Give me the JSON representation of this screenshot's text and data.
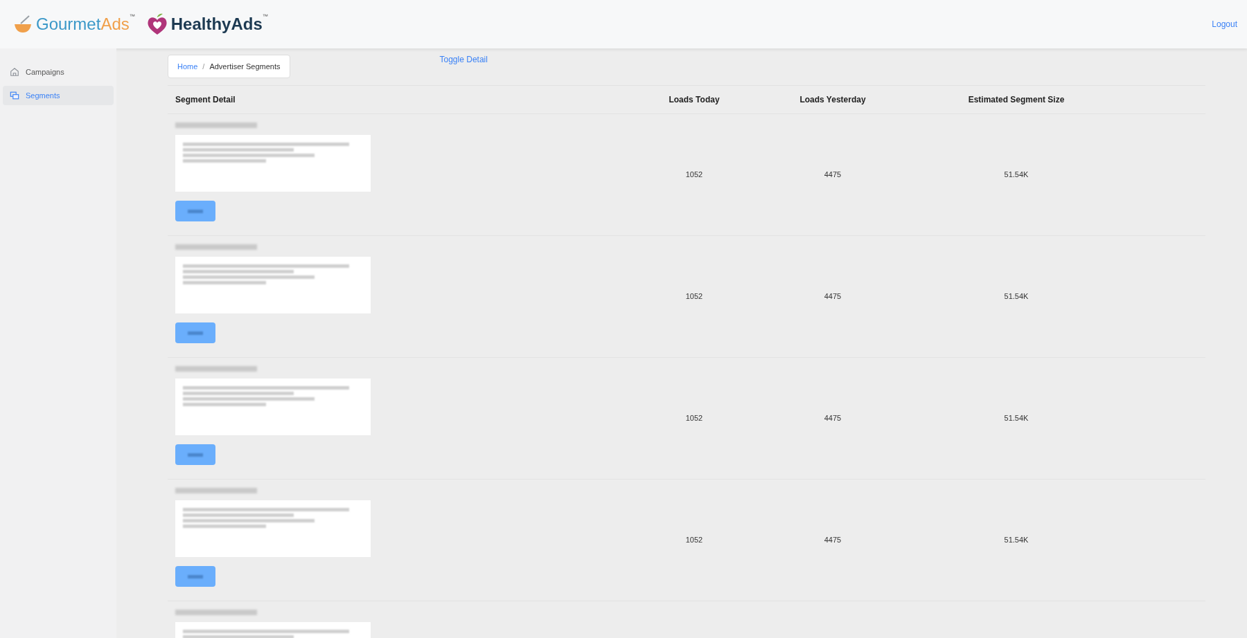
{
  "header": {
    "logos": [
      {
        "name": "Gourmet",
        "accent": "Ads",
        "mark": "™"
      },
      {
        "name": "Healthy",
        "accent": "Ads",
        "mark": "™"
      }
    ],
    "logout": "Logout"
  },
  "sidebar": {
    "items": [
      {
        "label": "Campaigns",
        "kind": "home",
        "selected": false
      },
      {
        "label": "Segments",
        "kind": "segments",
        "selected": true
      }
    ]
  },
  "breadcrumb": {
    "separator": "/",
    "items": [
      {
        "label": "Home",
        "link": true
      },
      {
        "label": "Advertiser Segments",
        "link": false
      }
    ]
  },
  "toggle_detail": "Toggle Detail",
  "table": {
    "columns": [
      "Segment Detail",
      "Loads Today",
      "Loads Yesterday",
      "Estimated Segment Size"
    ],
    "rows": [
      {
        "loads_today": "1052",
        "loads_yesterday": "4475",
        "size": "51.54K"
      },
      {
        "loads_today": "1052",
        "loads_yesterday": "4475",
        "size": "51.54K"
      },
      {
        "loads_today": "1052",
        "loads_yesterday": "4475",
        "size": "51.54K"
      },
      {
        "loads_today": "1052",
        "loads_yesterday": "4475",
        "size": "51.54K"
      },
      {}
    ]
  }
}
